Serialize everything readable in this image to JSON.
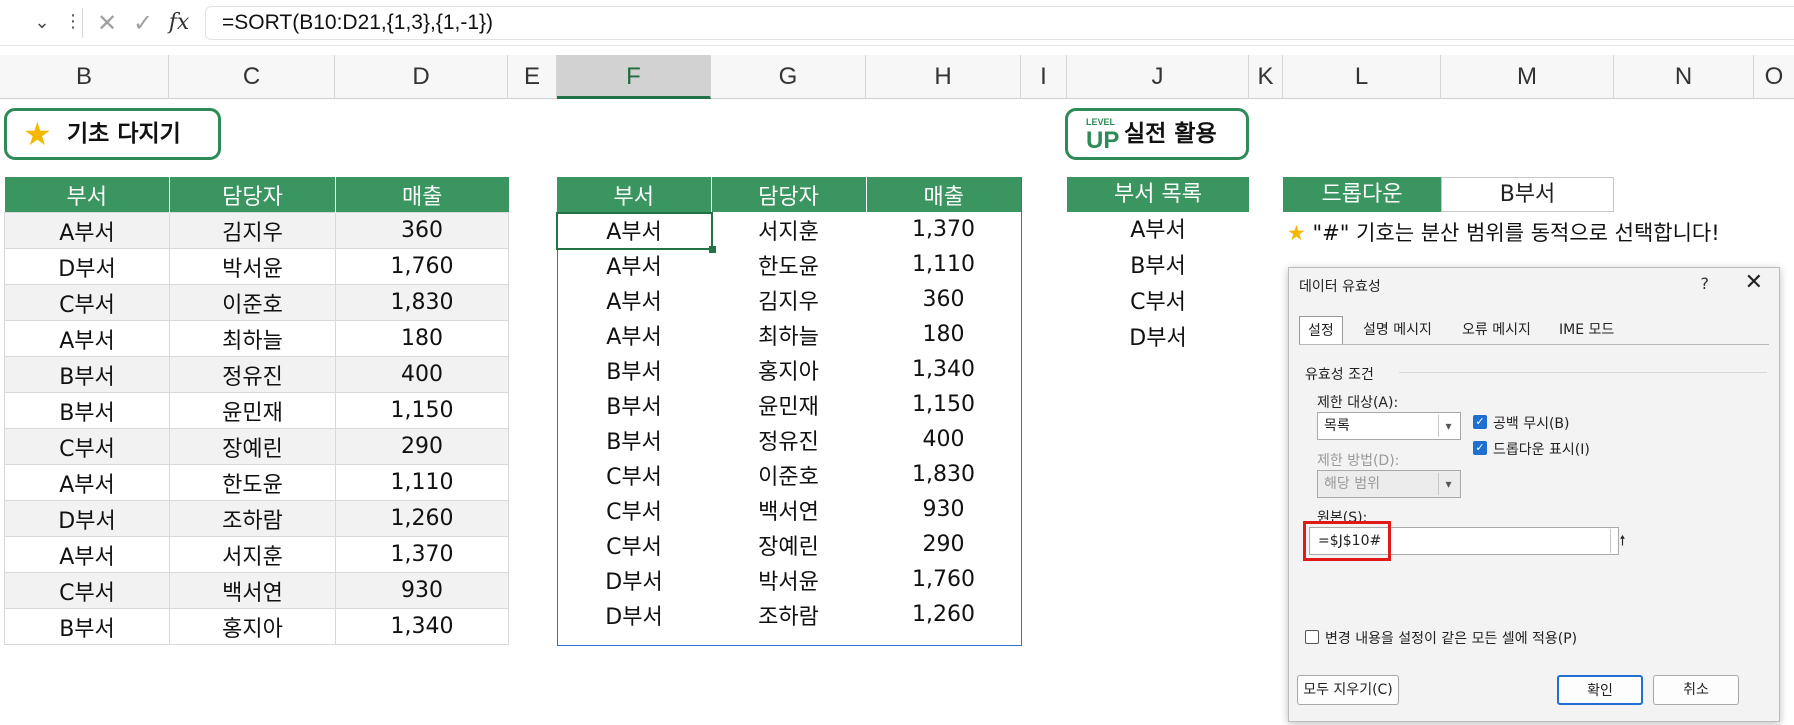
{
  "formula_bar": {
    "namebox_caret": "⌄",
    "dots": "⋮",
    "cancel_icon": "✕",
    "enter_icon": "✓",
    "fx": "fx",
    "formula": "=SORT(B10:D21,{1,3},{1,-1})"
  },
  "columns": [
    "B",
    "C",
    "D",
    "E",
    "F",
    "G",
    "H",
    "I",
    "J",
    "K",
    "L",
    "M",
    "N",
    "O"
  ],
  "selected_column": "F",
  "badges": {
    "basic": {
      "icon": "★",
      "text": "기초 다지기"
    },
    "level_up": {
      "icon_top": "LEVEL",
      "icon_bottom": "UP",
      "text": "실전 활용"
    }
  },
  "source_table": {
    "headers": [
      "부서",
      "담당자",
      "매출"
    ],
    "rows": [
      [
        "A부서",
        "김지우",
        "360"
      ],
      [
        "D부서",
        "박서윤",
        "1,760"
      ],
      [
        "C부서",
        "이준호",
        "1,830"
      ],
      [
        "A부서",
        "최하늘",
        "180"
      ],
      [
        "B부서",
        "정유진",
        "400"
      ],
      [
        "B부서",
        "윤민재",
        "1,150"
      ],
      [
        "C부서",
        "장예린",
        "290"
      ],
      [
        "A부서",
        "한도윤",
        "1,110"
      ],
      [
        "D부서",
        "조하람",
        "1,260"
      ],
      [
        "A부서",
        "서지훈",
        "1,370"
      ],
      [
        "C부서",
        "백서연",
        "930"
      ],
      [
        "B부서",
        "홍지아",
        "1,340"
      ]
    ]
  },
  "result_table": {
    "headers": [
      "부서",
      "담당자",
      "매출"
    ],
    "rows": [
      [
        "A부서",
        "서지훈",
        "1,370"
      ],
      [
        "A부서",
        "한도윤",
        "1,110"
      ],
      [
        "A부서",
        "김지우",
        "360"
      ],
      [
        "A부서",
        "최하늘",
        "180"
      ],
      [
        "B부서",
        "홍지아",
        "1,340"
      ],
      [
        "B부서",
        "윤민재",
        "1,150"
      ],
      [
        "B부서",
        "정유진",
        "400"
      ],
      [
        "C부서",
        "이준호",
        "1,830"
      ],
      [
        "C부서",
        "백서연",
        "930"
      ],
      [
        "C부서",
        "장예린",
        "290"
      ],
      [
        "D부서",
        "박서윤",
        "1,760"
      ],
      [
        "D부서",
        "조하람",
        "1,260"
      ]
    ]
  },
  "dept_list": {
    "header": "부서 목록",
    "items": [
      "A부서",
      "B부서",
      "C부서",
      "D부서"
    ]
  },
  "dropdown": {
    "label": "드롭다운",
    "value": "B부서"
  },
  "tip": {
    "icon": "★",
    "text": "\"#\" 기호는 분산 범위를 동적으로 선택합니다!"
  },
  "dialog": {
    "title": "데이터 유효성",
    "help": "?",
    "close": "✕",
    "tabs": [
      "설정",
      "설명 메시지",
      "오류 메시지",
      "IME 모드"
    ],
    "active_tab": "설정",
    "group_label": "유효성 조건",
    "allow_label": "제한 대상(A):",
    "allow_value": "목록",
    "data_label": "제한 방법(D):",
    "data_value": "해당 범위",
    "ignore_blank": {
      "label": "공백 무시(B)",
      "checked": true
    },
    "in_cell_dropdown": {
      "label": "드롭다운 표시(I)",
      "checked": true
    },
    "source_label": "원본(S):",
    "source_value": "=$J$10#",
    "apply_all": {
      "label": "변경 내용을 설정이 같은 모든 셀에 적용(P)",
      "checked": false
    },
    "clear_all": "모두 지우기(C)",
    "ok": "확인",
    "cancel": "취소"
  },
  "colors": {
    "header_green": "#3a9560",
    "excel_green": "#217346",
    "star": "#f5b800",
    "highlight_red": "#e01919",
    "checkbox_blue": "#1e6fd0",
    "selection_blue": "#2f6fd0"
  }
}
